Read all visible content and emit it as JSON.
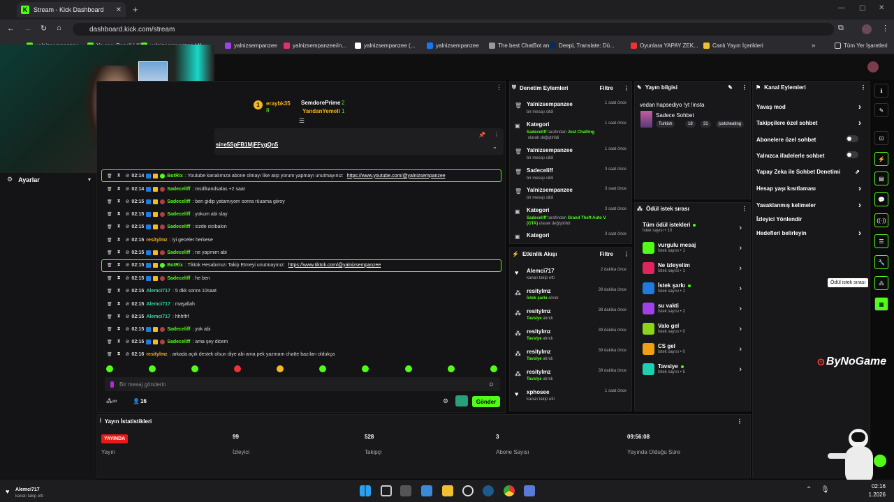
{
  "browser": {
    "tab_title": "Stream - Kick Dashboard",
    "url": "dashboard.kick.com/stream",
    "bookmarks": [
      "yalnizsempanzee",
      "Yayıncı Paneli | Kick",
      "yalnizsempanzee | K...",
      "yalnizsempanzee",
      "yalnizsempanzee/in...",
      "yalnizsempanzee (...",
      "yalnizsempanzee",
      "The best ChatBot an...",
      "DeepL Translate: Dü...",
      "Oyunlara YAPAY ZEK...",
      "Canlı Yayın İçerikleri"
    ],
    "all_bookmarks": "Tüm Yer İşaretleri"
  },
  "sidebar": {
    "settings_label": "Ayarlar"
  },
  "chat": {
    "leaderboard": {
      "first": "eraybk35",
      "first_count": "8",
      "second": "SemdorePrime",
      "second_count": "2",
      "third": "YandanYemeli",
      "third_count": "1"
    },
    "pinned_link": "si=e5SpFB1MjFFygQn5",
    "messages": [
      {
        "time": "02:14",
        "user": "BotRix",
        "text": ": Youtube kanalımıza abone olmayı like atıp yorum yapmayı unutmayınız: ",
        "link": "https://www.youtube.com/@yalnizsempanzee"
      },
      {
        "time": "02:14",
        "user": "Sadeceliff",
        "text": ": msdlkandsalas +2 saat"
      },
      {
        "time": "02:15",
        "user": "Sadeceliff",
        "text": ": ben gidip yatamıyom sonra rüuama giiroy"
      },
      {
        "time": "02:15",
        "user": "Sadeceliff",
        "text": ": yokum abi slay"
      },
      {
        "time": "02:15",
        "user": "Sadeceliff",
        "text": ": sizde cicibakın"
      },
      {
        "time": "02:15",
        "user": "resitylmz",
        "text": ": iyi geceler herkese"
      },
      {
        "time": "02:15",
        "user": "Sadeceliff",
        "text": ": ne yapmim abi"
      },
      {
        "time": "02:15",
        "user": "BotRix",
        "text": ": Tiktok Hesabımızı Takip Etmeyi unutmayınız: ",
        "link": "https://www.tiktok.com/@yalnizsempanzee"
      },
      {
        "time": "02:15",
        "user": "Sadeceliff",
        "text": ": he ben"
      },
      {
        "time": "02:15",
        "user": "Alemci717",
        "text": ": 5 dkk sonra 10saat"
      },
      {
        "time": "02:15",
        "user": "Alemci717",
        "text": ": maşallah"
      },
      {
        "time": "02:15",
        "user": "Alemci717",
        "text": ": hhhfhf"
      },
      {
        "time": "02:15",
        "user": "Sadeceliff",
        "text": ": yok abi"
      },
      {
        "time": "02:15",
        "user": "Sadeceliff",
        "text": ": ama şey dicem"
      },
      {
        "time": "02:16",
        "user": "resitylmz",
        "text": ": arkada açık destek olsun diye abi ama pek yazmam chatte bazıları oldukça"
      }
    ],
    "input_placeholder": "Bir mesaj gönderin",
    "viewer_count": "16",
    "send_label": "Gönder"
  },
  "moderation": {
    "title": "Denetim Eylemleri",
    "filter": "Filtre",
    "items": [
      {
        "name": "Yalnizsempanzee",
        "sub": "bir mesajı sildi",
        "time": "1 saat önce",
        "icon": "trash-icon"
      },
      {
        "name": "Kategori",
        "sub_user": "Sadeceliff",
        "sub_mid": " tarafından ",
        "sub_val": "Just Chatting",
        "sub_end": " olarak değiştirildi",
        "time": "1 saat önce",
        "icon": "category-icon"
      },
      {
        "name": "Yalnizsempanzee",
        "sub": "bir mesajı sildi",
        "time": "1 saat önce",
        "icon": "trash-icon"
      },
      {
        "name": "Sadeceliff",
        "sub": "bir mesajı sildi",
        "time": "3 saat önce",
        "icon": "trash-icon"
      },
      {
        "name": "Yalnizsempanzee",
        "sub": "bir mesajı sildi",
        "time": "3 saat önce",
        "icon": "trash-icon"
      },
      {
        "name": "Kategori",
        "sub_user": "Sadeceliff",
        "sub_mid": " tarafından ",
        "sub_val": "Grand Theft Auto V (GTA)",
        "sub_end": " olarak değiştirildi",
        "time": "3 saat önce",
        "icon": "category-icon"
      },
      {
        "name": "Kategori",
        "sub": "",
        "time": "3 saat önce",
        "icon": "category-icon"
      }
    ]
  },
  "activity": {
    "title": "Etkinlik Akışı",
    "filter": "Filtre",
    "items": [
      {
        "name": "Alemci717",
        "sub": "kanalı takip etti",
        "time": "2 dakika önce",
        "icon": "heart-icon"
      },
      {
        "name": "resitylmz",
        "sub": "İstek şarkı",
        "sub2": " alındı",
        "time": "39 dakika önce",
        "icon": "reward-icon"
      },
      {
        "name": "resitylmz",
        "sub": "Tavsiye",
        "sub2": " alındı",
        "time": "38 dakika önce",
        "icon": "reward-icon"
      },
      {
        "name": "resitylmz",
        "sub": "Tavsiye",
        "sub2": " alındı",
        "time": "39 dakika önce",
        "icon": "reward-icon"
      },
      {
        "name": "resitylmz",
        "sub": "Tavsiye",
        "sub2": " alındı",
        "time": "39 dakika önce",
        "icon": "reward-icon"
      },
      {
        "name": "resitylmz",
        "sub": "Tavsiye",
        "sub2": " alındı",
        "time": "39 dakika önce",
        "icon": "reward-icon"
      },
      {
        "name": "xphosee",
        "sub": "kanalı takip etti",
        "time": "1 saat önce",
        "icon": "heart-icon"
      }
    ]
  },
  "stream_info": {
    "title": "Yayın bilgisi",
    "stream_title": "vedan hapsediyo !yt !insta",
    "category": "Sadece Sohbet",
    "tags": [
      "Turkish",
      "18",
      "31",
      "justcheating"
    ]
  },
  "rewards": {
    "title": "Ödül istek sırası",
    "items": [
      {
        "name": "Tüm ödül istekleri",
        "sub": "İstek sayısı • 10",
        "color": "",
        "dot": true
      },
      {
        "name": "vurgulu mesaj",
        "sub": "İstek sayısı • 1",
        "color": "#53fc18"
      },
      {
        "name": "Ne izleyelim",
        "sub": "İstek sayısı • 1",
        "color": "#e0245e"
      },
      {
        "name": "İstek şarkı",
        "sub": "İstek sayısı • 1",
        "color": "#1e7be0",
        "dot": true
      },
      {
        "name": "su vakti",
        "sub": "İstek sayısı • 2",
        "color": "#a040e8"
      },
      {
        "name": "Valo gel",
        "sub": "İstek sayısı • 0",
        "color": "#8bd41b"
      },
      {
        "name": "CS gel",
        "sub": "İstek sayısı • 0",
        "color": "#f0a012"
      },
      {
        "name": "Tavsiye",
        "sub": "İstek sayısı • 5",
        "color": "#1fcfb0",
        "dot": true
      }
    ]
  },
  "channel_actions": {
    "title": "Kanal Eylemleri",
    "items": [
      {
        "label": "Yavaş mod",
        "control": "chevron"
      },
      {
        "label": "Takipçilere özel sohbet",
        "control": "chevron"
      },
      {
        "label": "Abonelere özel sohbet",
        "control": "toggle"
      },
      {
        "label": "Yalnızca ifadelerle sohbet",
        "control": "toggle"
      },
      {
        "label": "Yapay Zeka ile Sohbet Denetimi",
        "control": "external"
      },
      {
        "label": "Hesap yaşı kısıtlaması",
        "control": "chevron"
      },
      {
        "label": "Yasaklanmış kelimeler",
        "control": "chevron"
      },
      {
        "label": "İzleyici Yönlendir",
        "control": "none"
      },
      {
        "label": "Hedefleri belirleyin",
        "control": "chevron"
      }
    ]
  },
  "tooltip": "Ödül istek sırası",
  "stats": {
    "title": "Yayın İstatistikleri",
    "live_badge": "YAYINDA",
    "items": [
      {
        "value": "",
        "label": "Yayın"
      },
      {
        "value": "99",
        "label": "İzleyici"
      },
      {
        "value": "528",
        "label": "Takipçi"
      },
      {
        "value": "3",
        "label": "Abone Sayısı"
      },
      {
        "value": "09:56:08",
        "label": "Yayında Olduğu Süre"
      }
    ]
  },
  "watermark": "ByNoGame",
  "notification": {
    "user": "Alemci717",
    "sub": "kanalı takip etti"
  },
  "clock": {
    "time": "02:16",
    "date": "1.2026"
  },
  "colors": {
    "accent": "#53fc18",
    "background": "#0b0b0c",
    "panel": "#18181b"
  }
}
